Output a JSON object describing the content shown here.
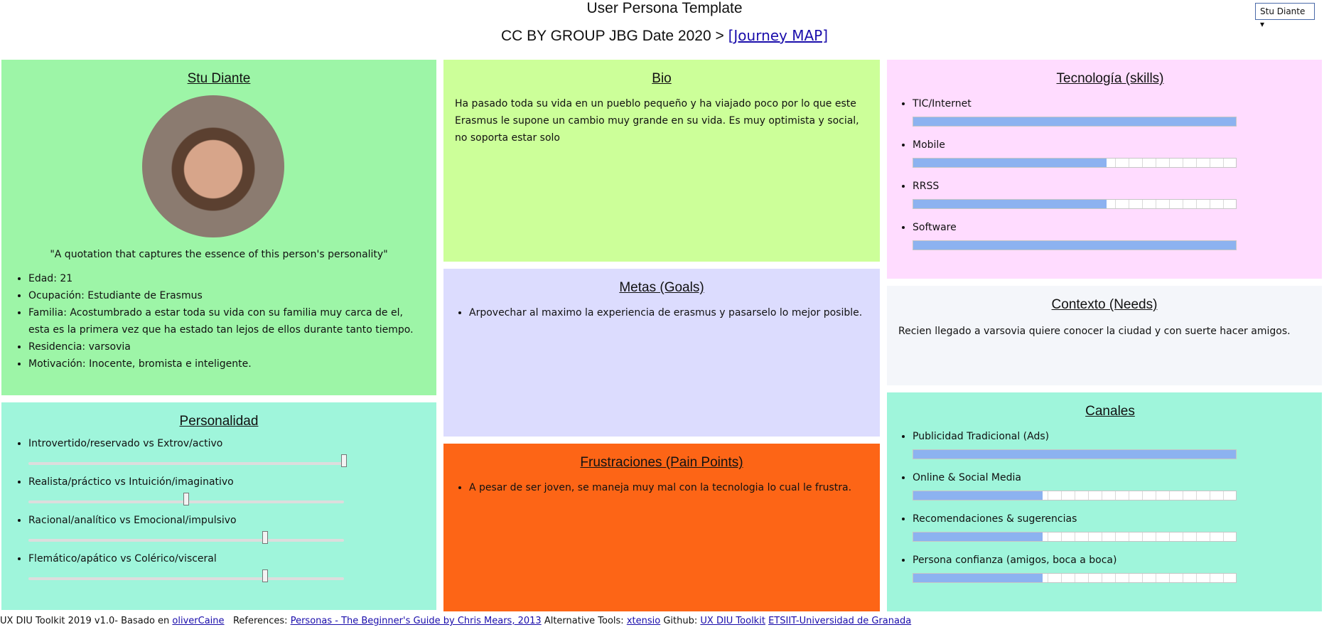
{
  "header": {
    "title": "User Persona Template",
    "subtitle": "CC BY GROUP JBG Date 2020 >",
    "journey_link": "[Journey MAP]",
    "persona_select": "Stu Diante ▾"
  },
  "profile": {
    "name": "Stu Diante",
    "quote": "\"A quotation that captures the essence of this person's personality\"",
    "details": [
      "Edad: 21",
      "Ocupación: Estudiante de Erasmus",
      "Familia: Acostumbrado a estar toda su vida con su familia muy carca de el, esta es la primera vez que ha estado tan lejos de ellos durante tanto tiempo.",
      "Residencia: varsovia",
      "Motivación: Inocente, bromista e inteligente."
    ]
  },
  "bio": {
    "title": "Bio",
    "text": "Ha pasado toda su vida en un pueblo pequeño y ha viajado poco por lo que este Erasmus le supone un cambio muy grande en su vida. Es muy optimista y social, no soporta estar solo"
  },
  "goals": {
    "title": "Metas (Goals)",
    "items": [
      "Arpovechar al maximo la experiencia de erasmus y pasarselo lo mejor posible."
    ]
  },
  "pains": {
    "title": "Frustraciones (Pain Points)",
    "items": [
      "A pesar de ser joven, se maneja muy mal con la tecnologia lo cual le frustra."
    ]
  },
  "personality": {
    "title": "Personalidad",
    "traits": [
      {
        "label": "Introvertido/reservado vs Extrov/activo",
        "value": 1.0
      },
      {
        "label": "Realista/práctico vs Intuición/imaginativo",
        "value": 0.5
      },
      {
        "label": "Racional/analítico vs Emocional/impulsivo",
        "value": 0.75
      },
      {
        "label": "Flemático/apático vs Colérico/visceral",
        "value": 0.75
      }
    ]
  },
  "tech": {
    "title": "Tecnología (skills)",
    "skills": [
      {
        "label": "TIC/Internet",
        "value": 1.0
      },
      {
        "label": "Mobile",
        "value": 0.6
      },
      {
        "label": "RRSS",
        "value": 0.6
      },
      {
        "label": "Software",
        "value": 1.0
      }
    ]
  },
  "context": {
    "title": "Contexto (Needs)",
    "text": "Recien llegado a varsovia quiere conocer la ciudad y con suerte hacer amigos."
  },
  "channels": {
    "title": "Canales",
    "items": [
      {
        "label": "Publicidad Tradicional (Ads)",
        "value": 1.0
      },
      {
        "label": "Online & Social Media",
        "value": 0.4
      },
      {
        "label": "Recomendaciones & sugerencias",
        "value": 0.4
      },
      {
        "label": "Persona confianza (amigos, boca a boca)",
        "value": 0.4
      }
    ]
  },
  "footer": {
    "prefix": "UX DIU Toolkit 2019 v1.0- Basado en",
    "link_olivercaine": "oliverCaine",
    "references_label": "References:",
    "link_personas": "Personas - The Beginner's Guide by Chris Mears, 2013",
    "alt_tools_label": "Alternative Tools:",
    "link_xtensio": "xtensio",
    "github_label": "Github:",
    "link_github": "UX DIU Toolkit",
    "link_ugr": "ETSIIT-Universidad de Granada"
  },
  "colors": {
    "profile_bg": "#9df5a7",
    "bio_bg": "#ccff99",
    "goals_bg": "#dcdcfe",
    "pains_bg": "#fd6516",
    "tech_bg": "#ffdcff",
    "context_bg": "#f4f6fa",
    "channels_bg": "#9ff5db",
    "personality_bg": "#9ff5db",
    "bar_fill": "#8cb2f0"
  }
}
